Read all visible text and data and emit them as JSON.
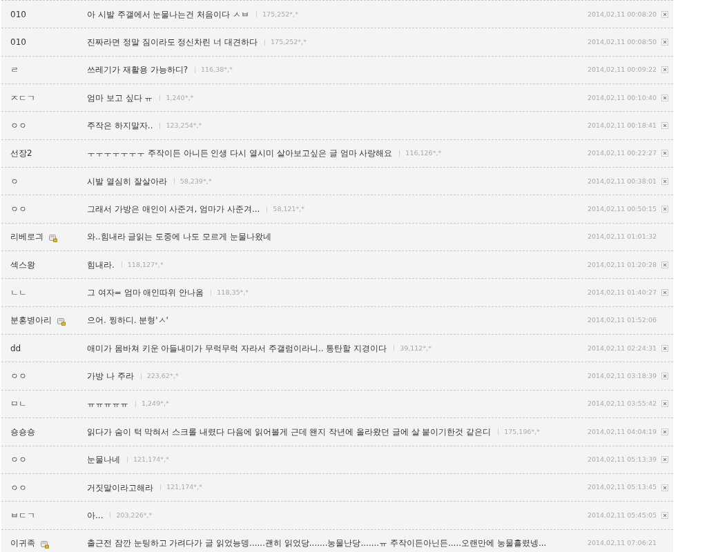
{
  "comments": [
    {
      "kind": "guest",
      "name": "010",
      "text": "아 시발 주갤에서 눈물나는건 처음이다 ㅅㅂ",
      "ip": "175,252*,*",
      "date": "2014,02,11 00:08:20"
    },
    {
      "kind": "guest",
      "name": "010",
      "text": "진짜라면 정말 짐이라도 정신차린 너 대견하다",
      "ip": "175,252*,*",
      "date": "2014,02,11 00:08:50"
    },
    {
      "kind": "guest",
      "name": "ㄹ",
      "text": "쓰레기가 재활용 가능하디?",
      "ip": "116,38*,*",
      "date": "2014,02,11 00:09:22"
    },
    {
      "kind": "guest",
      "name": "ㅈㄷㄱ",
      "text": "엄마 보고 싶다 ㅠ",
      "ip": "1,240*,*",
      "date": "2014,02,11 00:10:40"
    },
    {
      "kind": "guest",
      "name": "ㅇㅇ",
      "text": "주작은 하지말자..",
      "ip": "123,254*,*",
      "date": "2014,02,11 00:18:41"
    },
    {
      "kind": "guest",
      "name": "선장2",
      "text": "ㅜㅜㅜㅜㅜㅜㅜ 주작이든 아니든 인생 다시 열시미 살아보고싶은 글 엄마 사랑해요",
      "ip": "116,126*,*",
      "date": "2014,02,11 00:22:27"
    },
    {
      "kind": "guest",
      "name": "ㅇ",
      "text": "시발 열심히 잘살아라",
      "ip": "58,239*,*",
      "date": "2014,02,11 00:38:01"
    },
    {
      "kind": "guest",
      "name": "ㅇㅇ",
      "text": "그래서 가방은 애인이 사준겨, 엄마가 사준겨...",
      "ip": "58,121*,*",
      "date": "2014,02,11 00:50:15"
    },
    {
      "kind": "member",
      "name": "리베로긔",
      "text": "와..힘내라 글읽는 도중에 나도 모르게 눈물나왔네",
      "date": "2014,02,11 01:01:32"
    },
    {
      "kind": "guest",
      "name": "섹스왕",
      "text": "힘내라.",
      "ip": "118,127*,*",
      "date": "2014,02,11 01:20:28"
    },
    {
      "kind": "guest",
      "name": "ㄴㄴ",
      "text": "그 여자= 엄마 애인따위 안나옴",
      "ip": "118,35*,*",
      "date": "2014,02,11 01:40:27"
    },
    {
      "kind": "member",
      "name": "분홍병아리",
      "text": "으어. 찡하디. 분형'ㅅ'",
      "date": "2014,02,11 01:52:06"
    },
    {
      "kind": "guest",
      "name": "dd",
      "text": "애미가 몸바쳐 키운 아들내미가 무럭무럭 자라서 주갤럼이라니.. 통탄할 지경이다",
      "ip": "39,112*,*",
      "date": "2014,02,11 02:24:31"
    },
    {
      "kind": "guest",
      "name": "ㅇㅇ",
      "text": "가방 나 주라",
      "ip": "223,62*,*",
      "date": "2014,02,11 03:18:39"
    },
    {
      "kind": "guest",
      "name": "ㅁㄴ",
      "text": "ㅠㅠㅠㅠㅠ",
      "ip": "1,249*,*",
      "date": "2014,02,11 03:55:42"
    },
    {
      "kind": "guest",
      "name": "숑숑숑",
      "text": "읽다가 숨이 턱 막혀서 스크롤 내렸다 다음에 읽어볼게 근데 왠지 작년에 올라왔던 글에 살 붙이기한것 같은디",
      "ip": "175,196*,*",
      "date": "2014,02,11 04:04:19"
    },
    {
      "kind": "guest",
      "name": "ㅇㅇ",
      "text": "눈물나네",
      "ip": "121,174*,*",
      "date": "2014,02,11 05:13:39"
    },
    {
      "kind": "guest",
      "name": "ㅇㅇ",
      "text": "거짓말이라고해라",
      "ip": "121,174*,*",
      "date": "2014,02,11 05:13:45"
    },
    {
      "kind": "guest",
      "name": "ㅂㄷㄱ",
      "text": "아...",
      "ip": "203,226*,*",
      "date": "2014,02,11 05:45:05"
    },
    {
      "kind": "member",
      "name": "이귀족",
      "text": "출근전 잠깐 눈팅하고 가려다가 글 읽었능뎅......괜히 읽었당.......눙물난당.......ㅠ 주작이든아닌든.....오랜만에 눙물흘렸넹...",
      "date": "2014,02,11 07:06:21"
    }
  ]
}
